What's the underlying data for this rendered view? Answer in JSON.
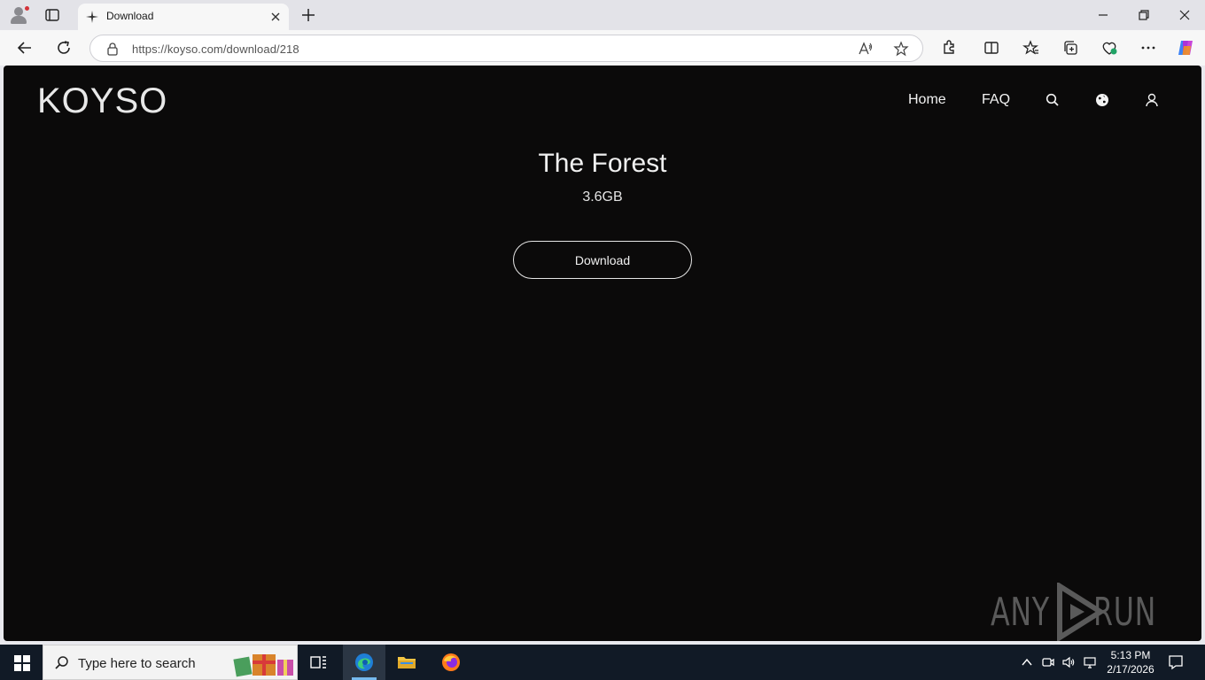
{
  "browser": {
    "tab": {
      "title": "Download"
    },
    "address_bar": {
      "url": "https://koyso.com/download/218"
    }
  },
  "site": {
    "logo": "KOYSO",
    "nav": {
      "home": "Home",
      "faq": "FAQ"
    }
  },
  "game": {
    "title": "The Forest",
    "size": "3.6GB",
    "download_label": "Download"
  },
  "watermark": {
    "left": "ANY",
    "right": "RUN"
  },
  "taskbar": {
    "search_placeholder": "Type here to search",
    "time": "5:13 PM",
    "date": "2/17/2026"
  },
  "colors": {
    "page_bg": "#0b0a0a",
    "taskbar_bg": "#111a26",
    "accent_edge": "#76b9ed"
  }
}
